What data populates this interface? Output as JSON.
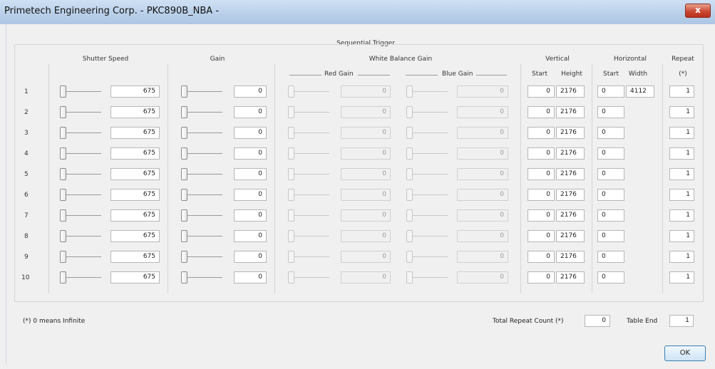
{
  "window": {
    "title": "Primetech Engineering Corp. - PKC890B_NBA -",
    "close_label": "x"
  },
  "group_title": "Sequential Trigger",
  "headers": {
    "shutter": "Shutter Speed",
    "gain": "Gain",
    "wb": "White Balance Gain",
    "red": "Red Gain",
    "blue": "Blue Gain",
    "vertical": "Vertical",
    "v_start": "Start",
    "v_height": "Height",
    "horizontal": "Horizontal",
    "h_start": "Start",
    "h_width": "Width",
    "repeat": "Repeat",
    "repeat_note": "(*)"
  },
  "rows": [
    {
      "num": "1",
      "shutter": "675",
      "gain": "0",
      "red": "0",
      "blue": "0",
      "v_start": "0",
      "v_height": "2176",
      "h_start": "0",
      "h_width": "4112",
      "repeat": "1"
    },
    {
      "num": "2",
      "shutter": "675",
      "gain": "0",
      "red": "0",
      "blue": "0",
      "v_start": "0",
      "v_height": "2176",
      "h_start": "0",
      "h_width": "",
      "repeat": "1"
    },
    {
      "num": "3",
      "shutter": "675",
      "gain": "0",
      "red": "0",
      "blue": "0",
      "v_start": "0",
      "v_height": "2176",
      "h_start": "0",
      "h_width": "",
      "repeat": "1"
    },
    {
      "num": "4",
      "shutter": "675",
      "gain": "0",
      "red": "0",
      "blue": "0",
      "v_start": "0",
      "v_height": "2176",
      "h_start": "0",
      "h_width": "",
      "repeat": "1"
    },
    {
      "num": "5",
      "shutter": "675",
      "gain": "0",
      "red": "0",
      "blue": "0",
      "v_start": "0",
      "v_height": "2176",
      "h_start": "0",
      "h_width": "",
      "repeat": "1"
    },
    {
      "num": "6",
      "shutter": "675",
      "gain": "0",
      "red": "0",
      "blue": "0",
      "v_start": "0",
      "v_height": "2176",
      "h_start": "0",
      "h_width": "",
      "repeat": "1"
    },
    {
      "num": "7",
      "shutter": "675",
      "gain": "0",
      "red": "0",
      "blue": "0",
      "v_start": "0",
      "v_height": "2176",
      "h_start": "0",
      "h_width": "",
      "repeat": "1"
    },
    {
      "num": "8",
      "shutter": "675",
      "gain": "0",
      "red": "0",
      "blue": "0",
      "v_start": "0",
      "v_height": "2176",
      "h_start": "0",
      "h_width": "",
      "repeat": "1"
    },
    {
      "num": "9",
      "shutter": "675",
      "gain": "0",
      "red": "0",
      "blue": "0",
      "v_start": "0",
      "v_height": "2176",
      "h_start": "0",
      "h_width": "",
      "repeat": "1"
    },
    {
      "num": "10",
      "shutter": "675",
      "gain": "0",
      "red": "0",
      "blue": "0",
      "v_start": "0",
      "v_height": "2176",
      "h_start": "0",
      "h_width": "",
      "repeat": "1"
    }
  ],
  "footer": {
    "note": "(*) 0 means Infinite",
    "total_repeat_label": "Total Repeat Count (*)",
    "total_repeat_value": "0",
    "table_end_label": "Table End",
    "table_end_value": "1",
    "ok_label": "OK"
  }
}
